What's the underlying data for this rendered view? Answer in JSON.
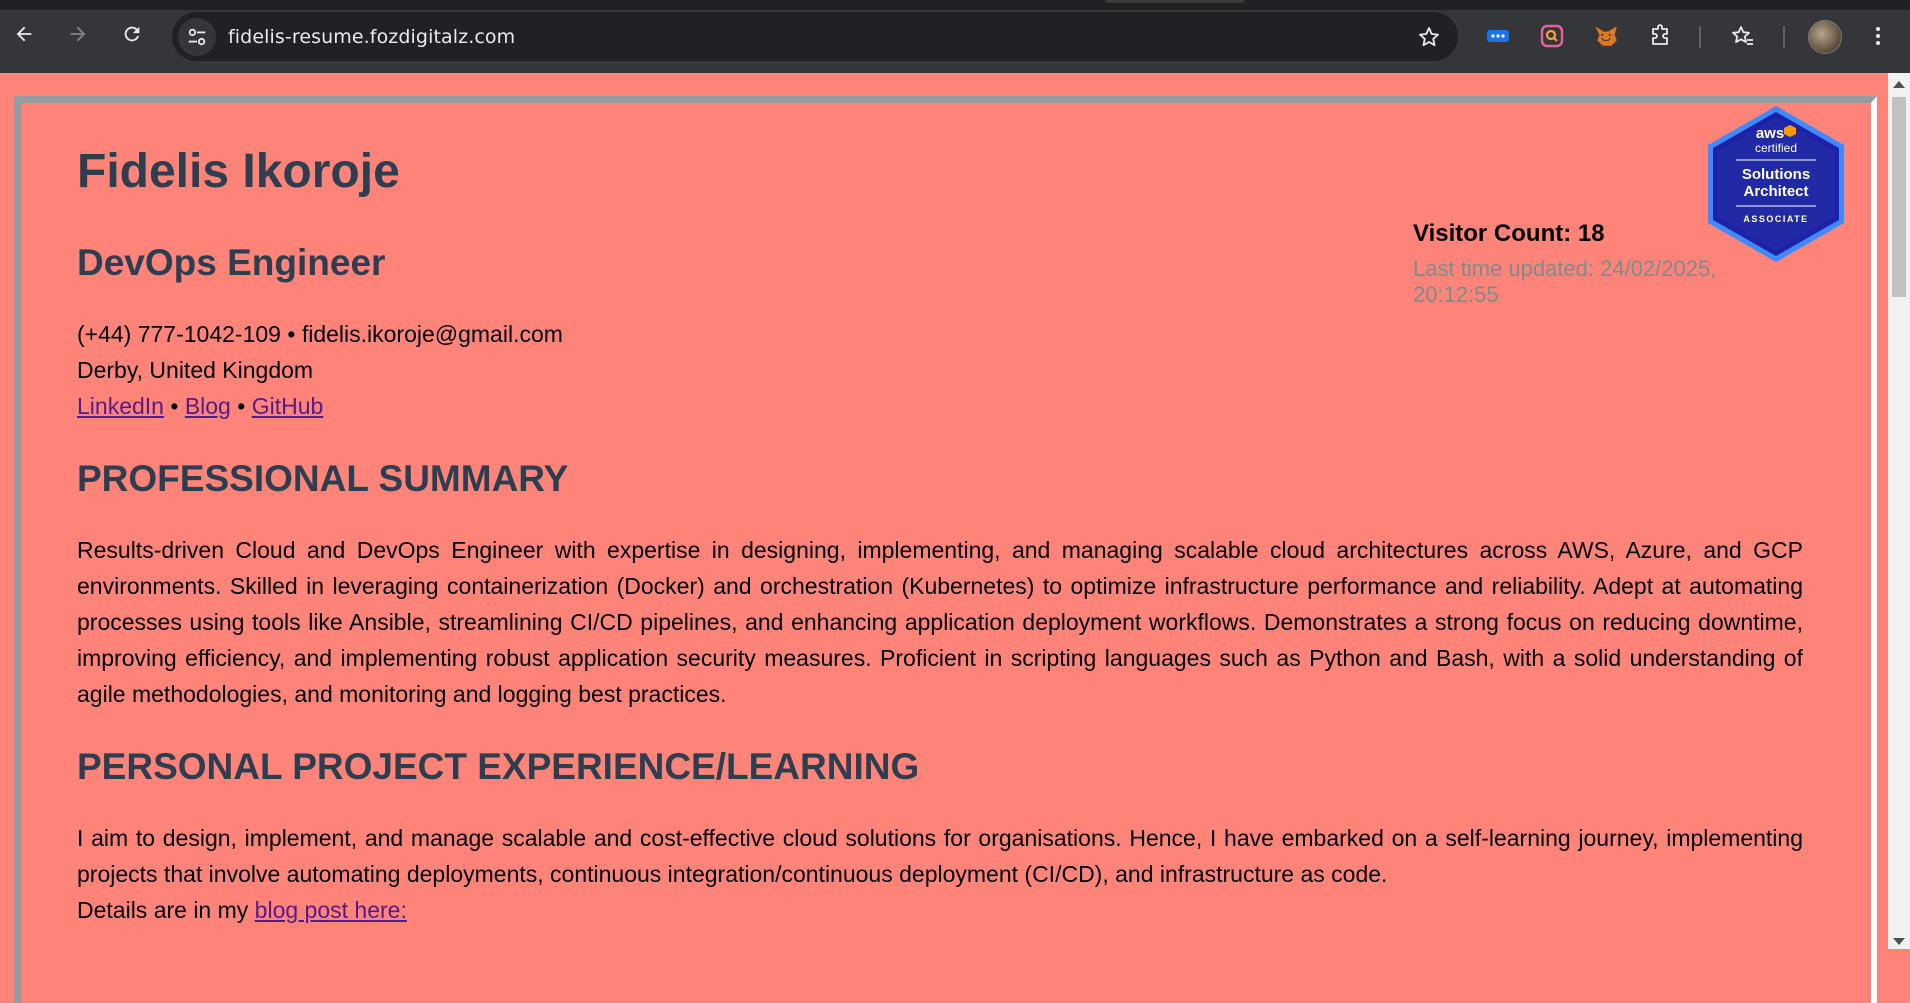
{
  "browser": {
    "url": "fidelis-resume.fozdigitalz.com"
  },
  "resume": {
    "name": "Fidelis Ikoroje",
    "role": "DevOps Engineer",
    "phone": "(+44) 777-1042-109",
    "separator": "•",
    "email": "fidelis.ikoroje@gmail.com",
    "location": "Derby, United Kingdom",
    "links": {
      "linkedin": "LinkedIn",
      "blog": "Blog",
      "github": "GitHub"
    },
    "visitor": {
      "count_label": "Visitor Count: 18",
      "updated_label": "Last time updated: 24/02/2025, 20:12:55"
    },
    "badge": {
      "line1": "aws",
      "line2": "certified",
      "line3": "Solutions",
      "line4": "Architect",
      "line5": "ASSOCIATE"
    },
    "summary": {
      "title": "PROFESSIONAL SUMMARY",
      "text": "Results-driven Cloud and DevOps Engineer with expertise in designing, implementing, and managing scalable cloud architectures across AWS, Azure, and GCP environments. Skilled in leveraging containerization (Docker) and orchestration (Kubernetes) to optimize infrastructure performance and reliability. Adept at automating processes using tools like Ansible, streamlining CI/CD pipelines, and enhancing application deployment workflows. Demonstrates a strong focus on reducing downtime, improving efficiency, and implementing robust application security measures. Proficient in scripting languages such as Python and Bash, with a solid understanding of agile methodologies, and monitoring and logging best practices."
    },
    "projects": {
      "title": "PERSONAL PROJECT EXPERIENCE/LEARNING",
      "text": "I aim to design, implement, and manage scalable and cost-effective cloud solutions for organisations. Hence, I have embarked on a self-learning journey, implementing projects that involve automating deployments, continuous integration/continuous deployment (CI/CD), and infrastructure as code.",
      "details_prefix": "Details are in my ",
      "details_link": "blog post here:"
    }
  }
}
